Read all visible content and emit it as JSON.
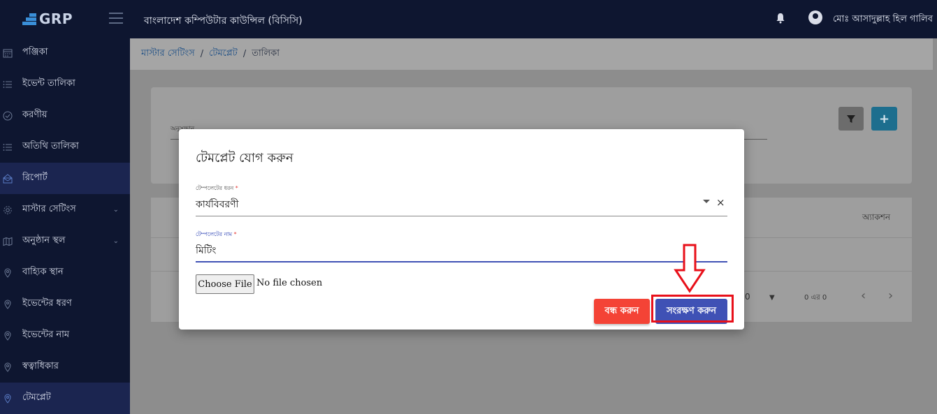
{
  "app": {
    "logo_text": "GRP",
    "org_title": "বাংলাদেশ কম্পিউটার কাউন্সিল (বিসিসি)",
    "user_name": "মোঃ আসাদুল্লাহ হিল গালিব"
  },
  "sidebar": {
    "items": [
      {
        "label": "পঞ্জিকা",
        "icon": "calendar-icon"
      },
      {
        "label": "ইভেন্ট তালিকা",
        "icon": "list-icon"
      },
      {
        "label": "করণীয়",
        "icon": "check-circle-icon"
      },
      {
        "label": "অতিথি তালিকা",
        "icon": "list-icon"
      },
      {
        "label": "রিপোর্ট",
        "icon": "report-icon"
      },
      {
        "label": "মাস্টার সেটিংস",
        "icon": "gear-icon"
      },
      {
        "label": "অনুষ্ঠান স্থল",
        "icon": "map-icon"
      },
      {
        "label": "বাহ্যিক স্থান",
        "icon": "location-pin-icon"
      },
      {
        "label": "ইভেন্টের ধরণ",
        "icon": "location-pin-icon"
      },
      {
        "label": "ইভেন্টের নাম",
        "icon": "location-pin-icon"
      },
      {
        "label": "স্বত্বাধিকার",
        "icon": "location-pin-icon"
      },
      {
        "label": "টেমপ্লেট",
        "icon": "location-pin-icon"
      }
    ]
  },
  "breadcrumb": {
    "master": "মাস্টার সেটিংস",
    "template": "টেমপ্লেট",
    "current": "তালিকা",
    "separator": "/"
  },
  "search": {
    "label": "অনুসন্ধান"
  },
  "toolbar": {
    "add_label": "+"
  },
  "table": {
    "action_header": "অ্যাকশন"
  },
  "pagination": {
    "page_value": "0",
    "info": "0 এর 0"
  },
  "modal": {
    "title": "টেমপ্লেট যোগ করুন",
    "type_label": "টেম্পলেটের ধরন",
    "type_value": "কার্যবিবরণী",
    "name_label": "টেম্পলেটের নাম",
    "name_value": "মিটিং",
    "required_mark": "*",
    "clear_symbol": "×",
    "choose_file": "Choose File",
    "no_file": "No file chosen",
    "close_label": "বন্ধ করুন",
    "save_label": "সংরক্ষণ করুন"
  },
  "colors": {
    "sidebar_bg": "#0e1630",
    "active_bg": "#1b2550",
    "primary": "#3f51b5",
    "danger": "#f44336",
    "annotation_red": "#e8101a"
  }
}
